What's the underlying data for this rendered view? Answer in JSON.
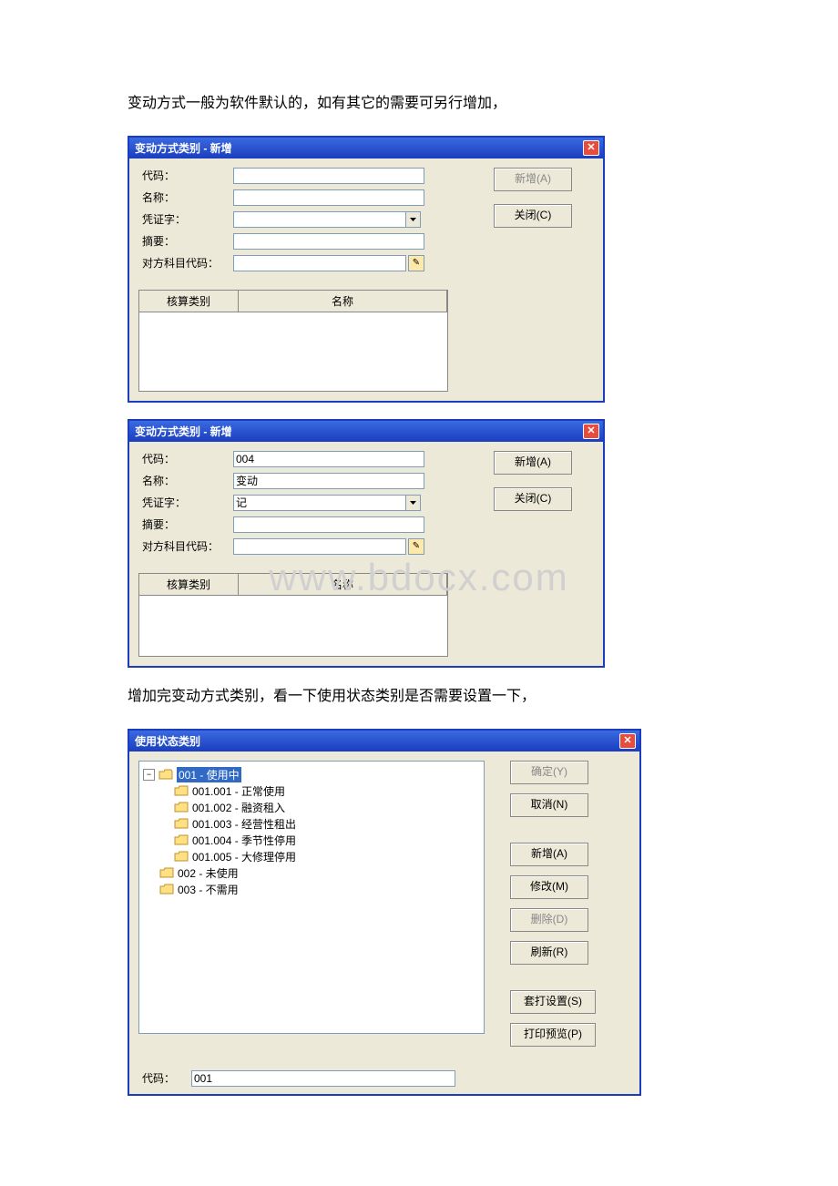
{
  "para1": "变动方式一般为软件默认的，如有其它的需要可另行增加，",
  "para2": "增加完变动方式类别，看一下使用状态类别是否需要设置一下，",
  "watermark": "www.bdocx.com",
  "dlg1": {
    "title": "变动方式类别 - 新增",
    "labels": {
      "code": "代码：",
      "name": "名称：",
      "voucher": "凭证字：",
      "summary": "摘要：",
      "acc": "对方科目代码："
    },
    "values": {
      "code": "",
      "name": "",
      "voucher": "",
      "summary": "",
      "acc": ""
    },
    "gridhead": {
      "c1": "核算类别",
      "c2": "名称"
    },
    "btns": {
      "add": "新增(A)",
      "close": "关闭(C)"
    }
  },
  "dlg2": {
    "title": "变动方式类别 - 新增",
    "labels": {
      "code": "代码：",
      "name": "名称：",
      "voucher": "凭证字：",
      "summary": "摘要：",
      "acc": "对方科目代码："
    },
    "values": {
      "code": "004",
      "name": "变动",
      "voucher": "记",
      "summary": "",
      "acc": ""
    },
    "gridhead": {
      "c1": "核算类别",
      "c2": "名称"
    },
    "btns": {
      "add": "新增(A)",
      "close": "关闭(C)"
    }
  },
  "dlg3": {
    "title": "使用状态类别",
    "tree": {
      "n0": "001 - 使用中",
      "n1": "001.001 - 正常使用",
      "n2": "001.002 - 融资租入",
      "n3": "001.003 - 经营性租出",
      "n4": "001.004 - 季节性停用",
      "n5": "001.005 - 大修理停用",
      "n6": "002 - 未使用",
      "n7": "003 - 不需用"
    },
    "codelabel": "代码：",
    "codevalue": "001",
    "btns": {
      "ok": "确定(Y)",
      "cancel": "取消(N)",
      "add": "新增(A)",
      "mod": "修改(M)",
      "del": "删除(D)",
      "ref": "刷新(R)",
      "set": "套打设置(S)",
      "prev": "打印预览(P)"
    }
  }
}
